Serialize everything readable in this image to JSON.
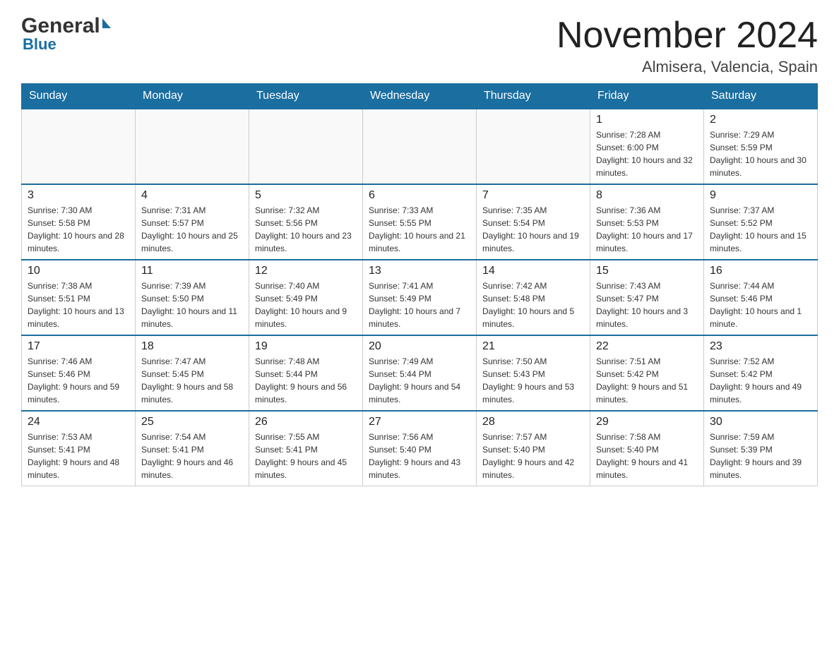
{
  "header": {
    "logo_general": "General",
    "logo_blue": "Blue",
    "month_title": "November 2024",
    "location": "Almisera, Valencia, Spain"
  },
  "days_of_week": [
    "Sunday",
    "Monday",
    "Tuesday",
    "Wednesday",
    "Thursday",
    "Friday",
    "Saturday"
  ],
  "weeks": [
    [
      {
        "day": "",
        "info": ""
      },
      {
        "day": "",
        "info": ""
      },
      {
        "day": "",
        "info": ""
      },
      {
        "day": "",
        "info": ""
      },
      {
        "day": "",
        "info": ""
      },
      {
        "day": "1",
        "info": "Sunrise: 7:28 AM\nSunset: 6:00 PM\nDaylight: 10 hours and 32 minutes."
      },
      {
        "day": "2",
        "info": "Sunrise: 7:29 AM\nSunset: 5:59 PM\nDaylight: 10 hours and 30 minutes."
      }
    ],
    [
      {
        "day": "3",
        "info": "Sunrise: 7:30 AM\nSunset: 5:58 PM\nDaylight: 10 hours and 28 minutes."
      },
      {
        "day": "4",
        "info": "Sunrise: 7:31 AM\nSunset: 5:57 PM\nDaylight: 10 hours and 25 minutes."
      },
      {
        "day": "5",
        "info": "Sunrise: 7:32 AM\nSunset: 5:56 PM\nDaylight: 10 hours and 23 minutes."
      },
      {
        "day": "6",
        "info": "Sunrise: 7:33 AM\nSunset: 5:55 PM\nDaylight: 10 hours and 21 minutes."
      },
      {
        "day": "7",
        "info": "Sunrise: 7:35 AM\nSunset: 5:54 PM\nDaylight: 10 hours and 19 minutes."
      },
      {
        "day": "8",
        "info": "Sunrise: 7:36 AM\nSunset: 5:53 PM\nDaylight: 10 hours and 17 minutes."
      },
      {
        "day": "9",
        "info": "Sunrise: 7:37 AM\nSunset: 5:52 PM\nDaylight: 10 hours and 15 minutes."
      }
    ],
    [
      {
        "day": "10",
        "info": "Sunrise: 7:38 AM\nSunset: 5:51 PM\nDaylight: 10 hours and 13 minutes."
      },
      {
        "day": "11",
        "info": "Sunrise: 7:39 AM\nSunset: 5:50 PM\nDaylight: 10 hours and 11 minutes."
      },
      {
        "day": "12",
        "info": "Sunrise: 7:40 AM\nSunset: 5:49 PM\nDaylight: 10 hours and 9 minutes."
      },
      {
        "day": "13",
        "info": "Sunrise: 7:41 AM\nSunset: 5:49 PM\nDaylight: 10 hours and 7 minutes."
      },
      {
        "day": "14",
        "info": "Sunrise: 7:42 AM\nSunset: 5:48 PM\nDaylight: 10 hours and 5 minutes."
      },
      {
        "day": "15",
        "info": "Sunrise: 7:43 AM\nSunset: 5:47 PM\nDaylight: 10 hours and 3 minutes."
      },
      {
        "day": "16",
        "info": "Sunrise: 7:44 AM\nSunset: 5:46 PM\nDaylight: 10 hours and 1 minute."
      }
    ],
    [
      {
        "day": "17",
        "info": "Sunrise: 7:46 AM\nSunset: 5:46 PM\nDaylight: 9 hours and 59 minutes."
      },
      {
        "day": "18",
        "info": "Sunrise: 7:47 AM\nSunset: 5:45 PM\nDaylight: 9 hours and 58 minutes."
      },
      {
        "day": "19",
        "info": "Sunrise: 7:48 AM\nSunset: 5:44 PM\nDaylight: 9 hours and 56 minutes."
      },
      {
        "day": "20",
        "info": "Sunrise: 7:49 AM\nSunset: 5:44 PM\nDaylight: 9 hours and 54 minutes."
      },
      {
        "day": "21",
        "info": "Sunrise: 7:50 AM\nSunset: 5:43 PM\nDaylight: 9 hours and 53 minutes."
      },
      {
        "day": "22",
        "info": "Sunrise: 7:51 AM\nSunset: 5:42 PM\nDaylight: 9 hours and 51 minutes."
      },
      {
        "day": "23",
        "info": "Sunrise: 7:52 AM\nSunset: 5:42 PM\nDaylight: 9 hours and 49 minutes."
      }
    ],
    [
      {
        "day": "24",
        "info": "Sunrise: 7:53 AM\nSunset: 5:41 PM\nDaylight: 9 hours and 48 minutes."
      },
      {
        "day": "25",
        "info": "Sunrise: 7:54 AM\nSunset: 5:41 PM\nDaylight: 9 hours and 46 minutes."
      },
      {
        "day": "26",
        "info": "Sunrise: 7:55 AM\nSunset: 5:41 PM\nDaylight: 9 hours and 45 minutes."
      },
      {
        "day": "27",
        "info": "Sunrise: 7:56 AM\nSunset: 5:40 PM\nDaylight: 9 hours and 43 minutes."
      },
      {
        "day": "28",
        "info": "Sunrise: 7:57 AM\nSunset: 5:40 PM\nDaylight: 9 hours and 42 minutes."
      },
      {
        "day": "29",
        "info": "Sunrise: 7:58 AM\nSunset: 5:40 PM\nDaylight: 9 hours and 41 minutes."
      },
      {
        "day": "30",
        "info": "Sunrise: 7:59 AM\nSunset: 5:39 PM\nDaylight: 9 hours and 39 minutes."
      }
    ]
  ],
  "colors": {
    "header_bg": "#1a6ea0",
    "header_text": "#ffffff",
    "border_top": "#1a6ea0"
  }
}
